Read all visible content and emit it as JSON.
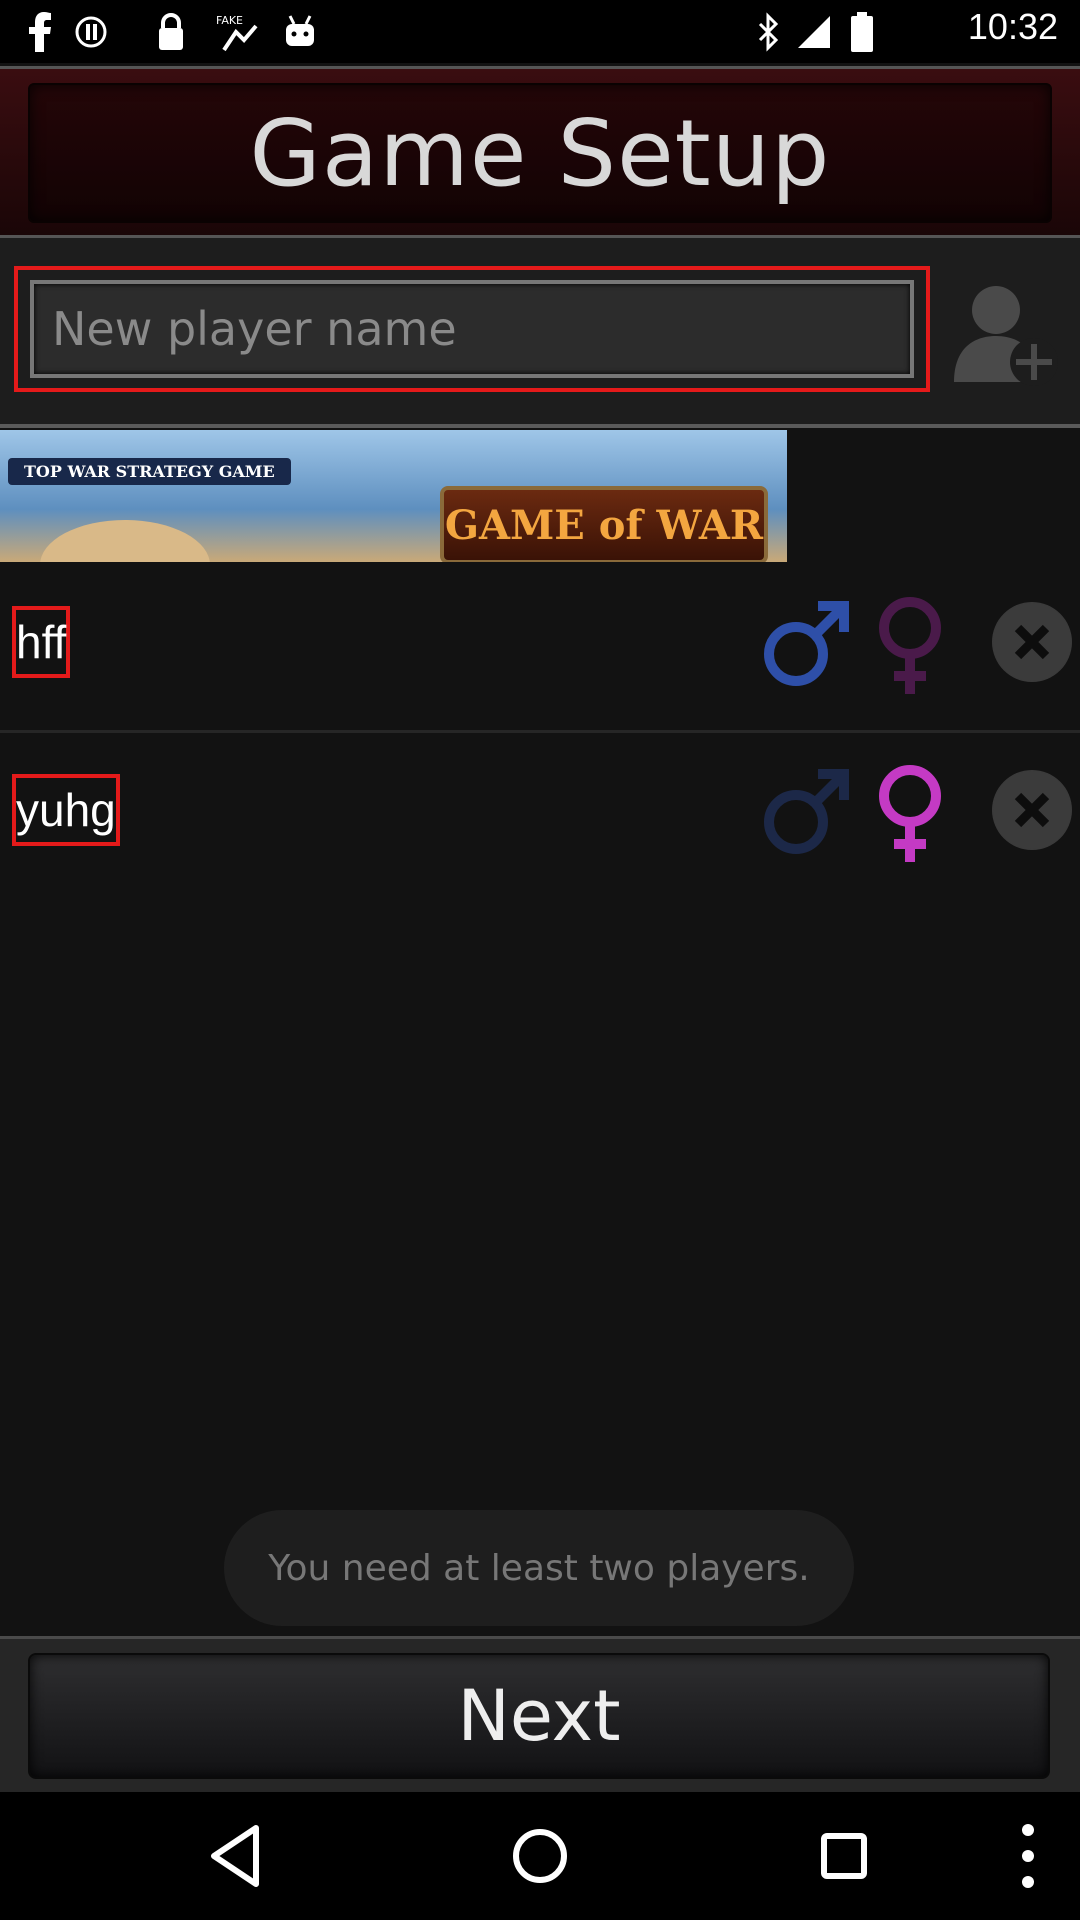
{
  "status_bar": {
    "time": "10:32",
    "left_icons": [
      "facebook-icon",
      "record-icon",
      "lock-icon",
      "fake-gps-icon",
      "android-icon"
    ],
    "right_icons": [
      "bluetooth-icon",
      "signal-icon",
      "battery-icon"
    ]
  },
  "header": {
    "title": "Game Setup"
  },
  "add_player": {
    "placeholder": "New player name",
    "value": "",
    "button_icon": "add-user-icon"
  },
  "ad": {
    "tagline": "TOP WAR STRATEGY GAME",
    "logo_text": "GAME of WAR"
  },
  "players": [
    {
      "name": "hff",
      "gender": "male"
    },
    {
      "name": "yuhg",
      "gender": "female"
    }
  ],
  "toast": {
    "message": "You need at least two players."
  },
  "footer": {
    "next_label": "Next"
  },
  "nav": {
    "buttons": [
      "back-icon",
      "home-icon",
      "recents-icon",
      "menu-icon"
    ]
  },
  "colors": {
    "male_active": "#2e4fa8",
    "male_inactive": "#1c2848",
    "female_active": "#c43ac4",
    "female_inactive": "#4a1a4a",
    "highlight": "#e41a1a"
  }
}
